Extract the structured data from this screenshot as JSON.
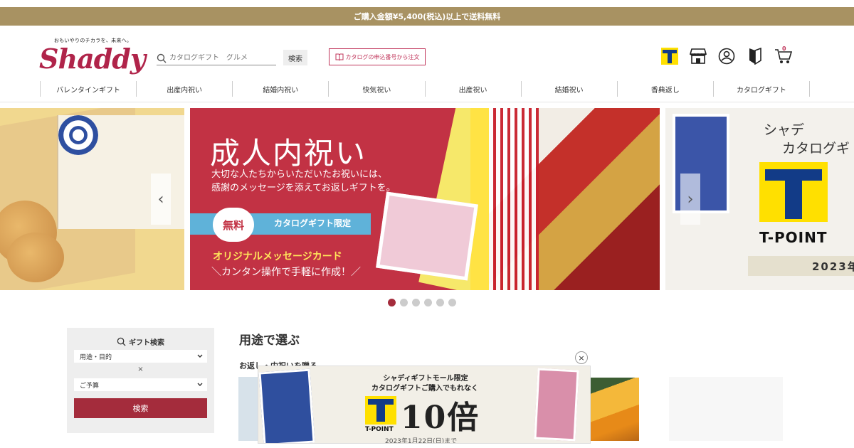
{
  "topbar": {
    "text": "ご購入金額¥5,400(税込)以上で送料無料"
  },
  "header": {
    "tagline": "おもいやりのチカラを、未来へ。",
    "logo": "Shaddy",
    "search_placeholder": "カタログギフト　グルメ",
    "search_button": "検索",
    "catalog_order": "カタログの申込番号から注文",
    "icons": [
      "t-point-icon",
      "store-icon",
      "account-icon",
      "beginner-icon",
      "cart-icon"
    ],
    "cart_count": "0"
  },
  "nav": [
    "バレンタインギフト",
    "出産内祝い",
    "結婚内祝い",
    "快気祝い",
    "出産祝い",
    "結婚祝い",
    "香典返し",
    "カタログギフト"
  ],
  "slider": {
    "main": {
      "title": "成人内祝い",
      "sub1": "大切な人たちからいただいたお祝いには、",
      "sub2": "感謝のメッセージを添えてお返しギフトを。",
      "free": "無料",
      "limit": "カタログギフト限定",
      "card": "オリジナルメッセージカード",
      "make": "＼カンタン操作で手軽に作成！／"
    },
    "right": {
      "title1": "シャデ",
      "title2": "カタログギ",
      "tpoint": "T-POINT",
      "year": "2023年"
    },
    "prev": "‹",
    "next": "›",
    "dot_count": 6,
    "active_dot": 0
  },
  "gift_search": {
    "title": "ギフト検索",
    "purpose": "用途・目的",
    "times": "×",
    "budget": "ご予算",
    "button": "検索"
  },
  "purpose": {
    "heading": "用途で選ぶ",
    "sub": "お返し・内祝いを贈る"
  },
  "popup": {
    "line1": "シャディギフトモール限定",
    "line2": "カタログギフトご購入でもれなく",
    "tpoint": "T-POINT",
    "big": "10倍",
    "date": "2023年1月22日(日)まで",
    "close": "×"
  },
  "colors": {
    "brand": "#b0244a",
    "gold": "#a89262",
    "accent": "#a42c3c"
  }
}
